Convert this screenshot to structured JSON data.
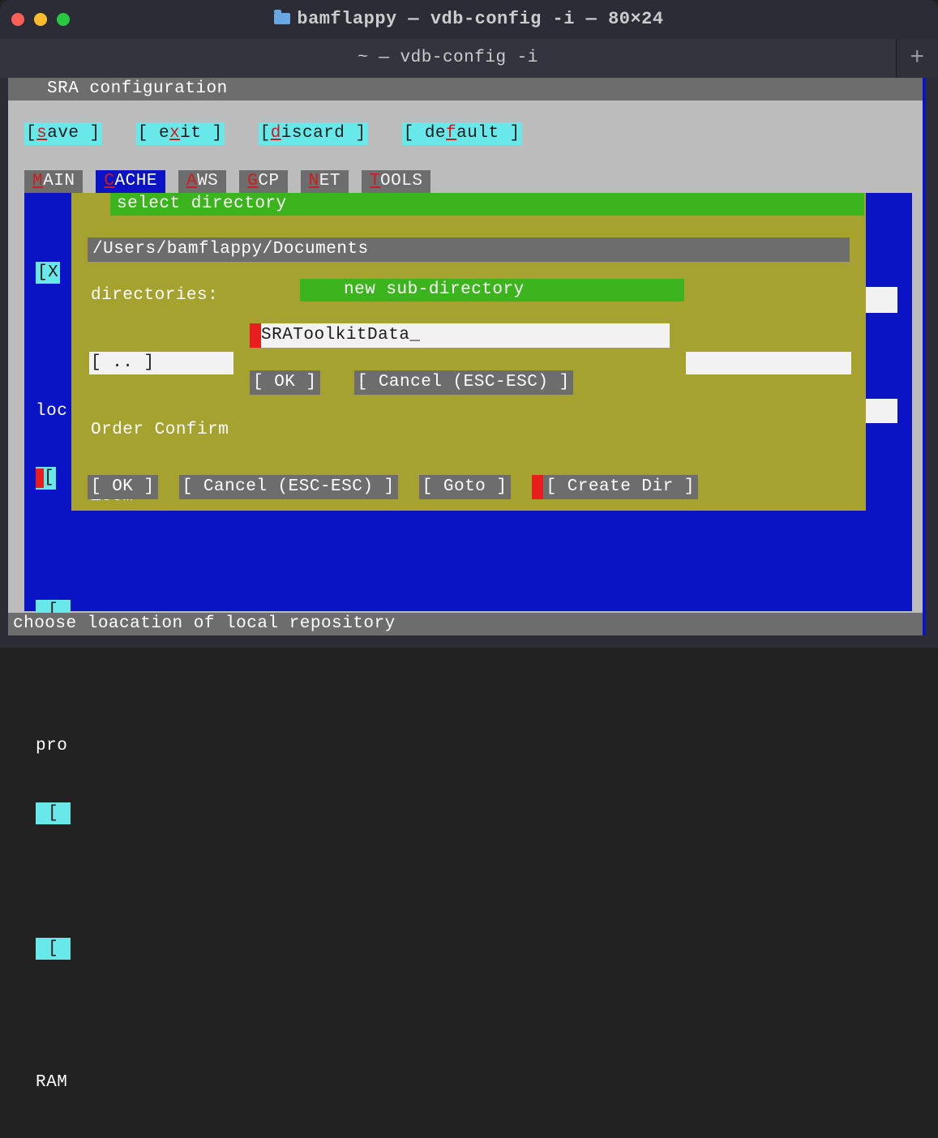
{
  "window": {
    "title": "bamflappy — vdb-config -i — 80×24",
    "tab_title": "~ — vdb-config -i"
  },
  "app": {
    "header": "SRA configuration",
    "footer": "choose loacation of local repository",
    "top_buttons": {
      "save": {
        "pre": "[   ",
        "hk": "s",
        "post": "ave   ]"
      },
      "exit": {
        "pre": "[   e",
        "hk": "x",
        "post": "it   ]"
      },
      "discard": {
        "pre": "[ ",
        "hk": "d",
        "post": "iscard  ]"
      },
      "default": {
        "pre": "[ de",
        "hk": "f",
        "post": "ault  ]"
      }
    },
    "tabs": {
      "main": {
        "hk": "M",
        "rest": "AIN"
      },
      "cache": {
        "hk": "C",
        "rest": "ACHE"
      },
      "aws": {
        "hk": "A",
        "rest": "WS"
      },
      "gcp": {
        "hk": "G",
        "rest": "CP"
      },
      "net": {
        "hk": "N",
        "rest": "ET"
      },
      "tools": {
        "hk": "T",
        "rest": "OOLS"
      }
    },
    "bg_labels": {
      "x_box": "[X",
      "loc": "loc",
      "brkt1": "[",
      "brkt2": " [ ",
      "pro": "pro",
      "brkt3": " [ ",
      "brkt4": " [ ",
      "ram": "RAM"
    }
  },
  "dialog": {
    "title": "select directory",
    "path": "/Users/bamflappy/Documents",
    "dir_label": "directories:",
    "items": {
      "up": "[ .. ]",
      "order": "Order Confirm",
      "zoom": "Zoom"
    },
    "buttons": {
      "ok": "[   OK   ]",
      "cancel": "[ Cancel (ESC-ESC) ]",
      "goto": "[   Goto   ]",
      "create": "[   Create Dir   ]"
    }
  },
  "subdialog": {
    "title": "new sub-directory",
    "input": "SRAToolkitData_",
    "buttons": {
      "ok": "[   OK   ]",
      "cancel": "[ Cancel (ESC-ESC) ]"
    }
  }
}
